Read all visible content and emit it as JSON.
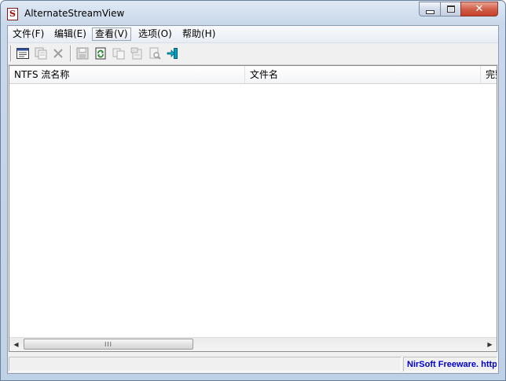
{
  "window": {
    "title": "AlternateStreamView",
    "app_icon_letter": "S",
    "close_glyph": "✕"
  },
  "menu": {
    "items": [
      {
        "label": "文件(F)",
        "active": false
      },
      {
        "label": "编辑(E)",
        "active": false
      },
      {
        "label": "查看(V)",
        "active": true
      },
      {
        "label": "选项(O)",
        "active": false
      },
      {
        "label": "帮助(H)",
        "active": false
      }
    ]
  },
  "toolbar": {
    "buttons": [
      {
        "icon": "properties-icon",
        "enabled": true
      },
      {
        "icon": "copy-streams-icon",
        "enabled": false
      },
      {
        "icon": "delete-icon",
        "enabled": false
      },
      {
        "icon": "save-icon",
        "enabled": false
      },
      {
        "icon": "refresh-icon",
        "enabled": true
      },
      {
        "icon": "copy-icon",
        "enabled": false
      },
      {
        "icon": "properties-page-icon",
        "enabled": false
      },
      {
        "icon": "find-icon",
        "enabled": false
      },
      {
        "icon": "exit-icon",
        "enabled": true
      }
    ]
  },
  "list": {
    "columns": [
      "NTFS 流名称",
      "文件名",
      "完整"
    ],
    "rows": []
  },
  "scrollbar": {
    "left_arrow": "◀",
    "right_arrow": "▶",
    "grip": "III"
  },
  "status": {
    "left_text": "",
    "link_text": "NirSoft Freeware.  http://www.nirsoft.net"
  },
  "colors": {
    "link": "#0000cc",
    "exit_icon": "#00a0c0",
    "refresh_icon": "#2a8a2a",
    "app_icon": "#b00000"
  }
}
